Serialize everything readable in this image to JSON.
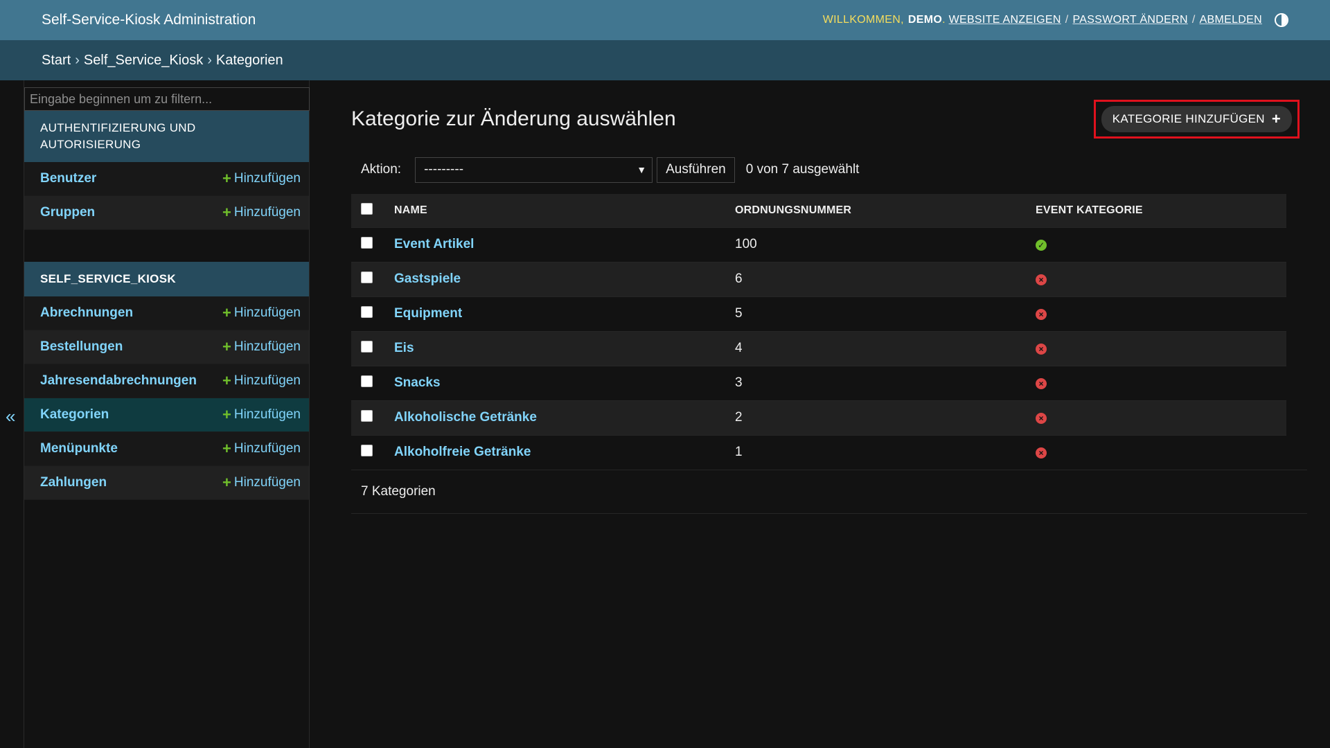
{
  "header": {
    "title": "Self-Service-Kiosk Administration",
    "welcome": "WILLKOMMEN,",
    "username": "DEMO",
    "view_site": "WEBSITE ANZEIGEN",
    "change_password": "PASSWORT ÄNDERN",
    "logout": "ABMELDEN",
    "separator": "/",
    "theme_icon": "contrast-icon"
  },
  "breadcrumbs": {
    "items": [
      "Start",
      "Self_Service_Kiosk",
      "Kategorien"
    ],
    "separator": "›"
  },
  "sidebar": {
    "filter_placeholder": "Eingabe beginnen um zu filtern...",
    "collapse_icon": "«",
    "add_label": "Hinzufügen",
    "modules": [
      {
        "caption": "AUTHENTIFIZIERUNG UND AUTORISIERUNG",
        "items": [
          {
            "label": "Benutzer"
          },
          {
            "label": "Gruppen"
          }
        ]
      },
      {
        "caption": "SELF_SERVICE_KIOSK",
        "items": [
          {
            "label": "Abrechnungen"
          },
          {
            "label": "Bestellungen"
          },
          {
            "label": "Jahresendabrechnungen"
          },
          {
            "label": "Kategorien"
          },
          {
            "label": "Menüpunkte"
          },
          {
            "label": "Zahlungen"
          }
        ]
      }
    ]
  },
  "content": {
    "title": "Kategorie zur Änderung auswählen",
    "add_button": "KATEGORIE HINZUFÜGEN",
    "action_label": "Aktion:",
    "action_value": "---------",
    "run_button": "Ausführen",
    "selection_counter": "0 von 7 ausgewählt",
    "columns": [
      "NAME",
      "ORDNUNGSNUMMER",
      "EVENT KATEGORIE"
    ],
    "rows": [
      {
        "name": "Event Artikel",
        "order": "100",
        "event": true
      },
      {
        "name": "Gastspiele",
        "order": "6",
        "event": false
      },
      {
        "name": "Equipment",
        "order": "5",
        "event": false
      },
      {
        "name": "Eis",
        "order": "4",
        "event": false
      },
      {
        "name": "Snacks",
        "order": "3",
        "event": false
      },
      {
        "name": "Alkoholische Getränke",
        "order": "2",
        "event": false
      },
      {
        "name": "Alkoholfreie Getränke",
        "order": "1",
        "event": false
      }
    ],
    "result_count": "7 Kategorien"
  },
  "colors": {
    "header_bg": "#417690",
    "breadcrumb_bg": "#264b5d",
    "link": "#81d4fa",
    "add_green": "#70bf2b",
    "no_red": "#dd4646",
    "highlight_border": "#e0111d"
  }
}
